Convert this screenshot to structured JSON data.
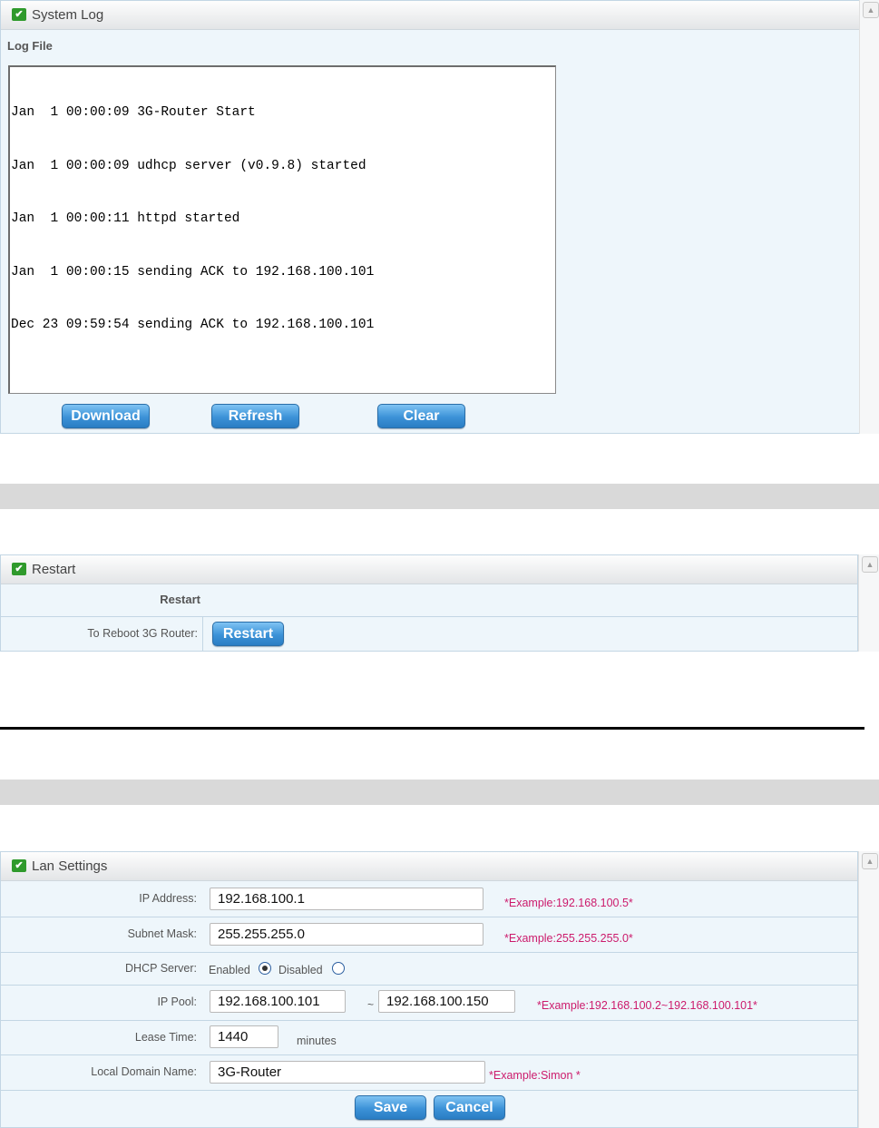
{
  "syslog": {
    "title": "System Log",
    "log_file_label": "Log File",
    "log_lines": [
      "Jan  1 00:00:09 3G-Router Start",
      "Jan  1 00:00:09 udhcp server (v0.9.8) started",
      "Jan  1 00:00:11 httpd started",
      "Jan  1 00:00:15 sending ACK to 192.168.100.101",
      "Dec 23 09:59:54 sending ACK to 192.168.100.101"
    ],
    "download_label": "Download",
    "refresh_label": "Refresh",
    "clear_label": "Clear"
  },
  "restart": {
    "title": "Restart",
    "section_heading": "Restart",
    "reboot_label": "To Reboot 3G Router:",
    "restart_button": "Restart"
  },
  "lan": {
    "title": "Lan Settings",
    "ip_address": {
      "label": "IP Address:",
      "value": "192.168.100.1",
      "example": "*Example:192.168.100.5*"
    },
    "subnet_mask": {
      "label": "Subnet Mask:",
      "value": "255.255.255.0",
      "example": "*Example:255.255.255.0*"
    },
    "dhcp": {
      "label": "DHCP Server:",
      "enabled_label": "Enabled",
      "disabled_label": "Disabled",
      "selected": "Enabled"
    },
    "ip_pool": {
      "label": "IP Pool:",
      "start": "192.168.100.101",
      "separator": "~",
      "end": "192.168.100.150",
      "example": "*Example:192.168.100.2~192.168.100.101*"
    },
    "lease_time": {
      "label": "Lease Time:",
      "value": "1440",
      "unit": "minutes"
    },
    "domain": {
      "label": "Local Domain Name:",
      "value": "3G-Router",
      "example": "*Example:Simon *"
    },
    "save_label": "Save",
    "cancel_label": "Cancel"
  },
  "colors": {
    "accent_button": "#3c92d7",
    "example_text": "#cc1b6c",
    "panel_bg": "#eef6fb",
    "title_icon": "#2f9a2c"
  },
  "icons": {
    "panel_title": "check-box-icon",
    "scroll_up": "chevron-up-icon"
  }
}
